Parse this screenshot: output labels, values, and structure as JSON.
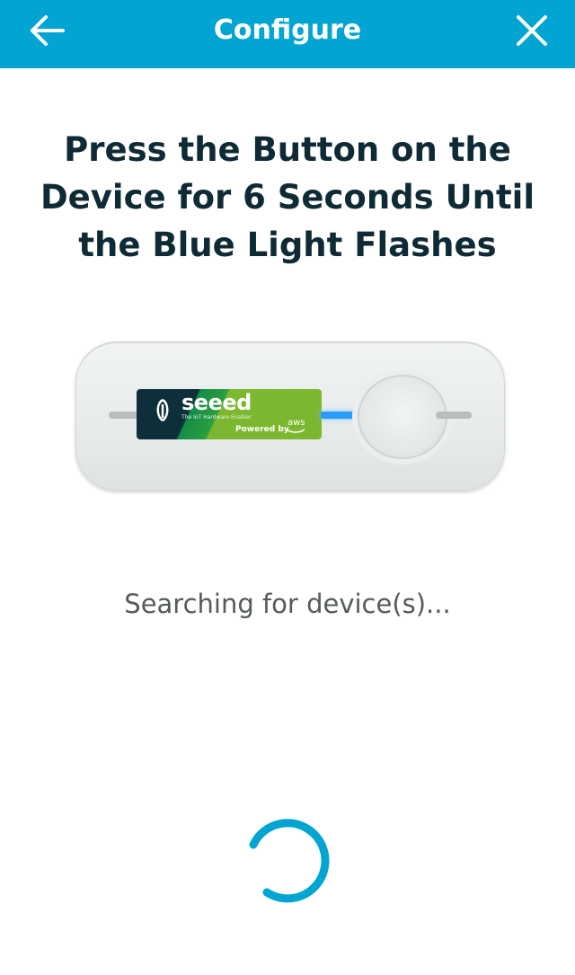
{
  "header": {
    "title": "Configure",
    "back_icon": "arrow-left-icon",
    "close_icon": "close-icon",
    "background_color": "#02a5d1"
  },
  "main": {
    "heading_line1": "Press the Button on the",
    "heading_line2": "Device for 6 Seconds Until",
    "heading_line3": "the Blue Light Flashes",
    "status_text": "Searching for device(s)..."
  },
  "device_image": {
    "brand": "seeed",
    "brand_tagline": "The IoT Hardware Enabler",
    "powered_by": "Powered by",
    "aws_mark": "aws",
    "led_color": "#2a9bff"
  },
  "colors": {
    "accent": "#02a5d1",
    "heading": "#0e2a35",
    "status_text": "#555a5c",
    "spinner": "#02a5d1"
  }
}
